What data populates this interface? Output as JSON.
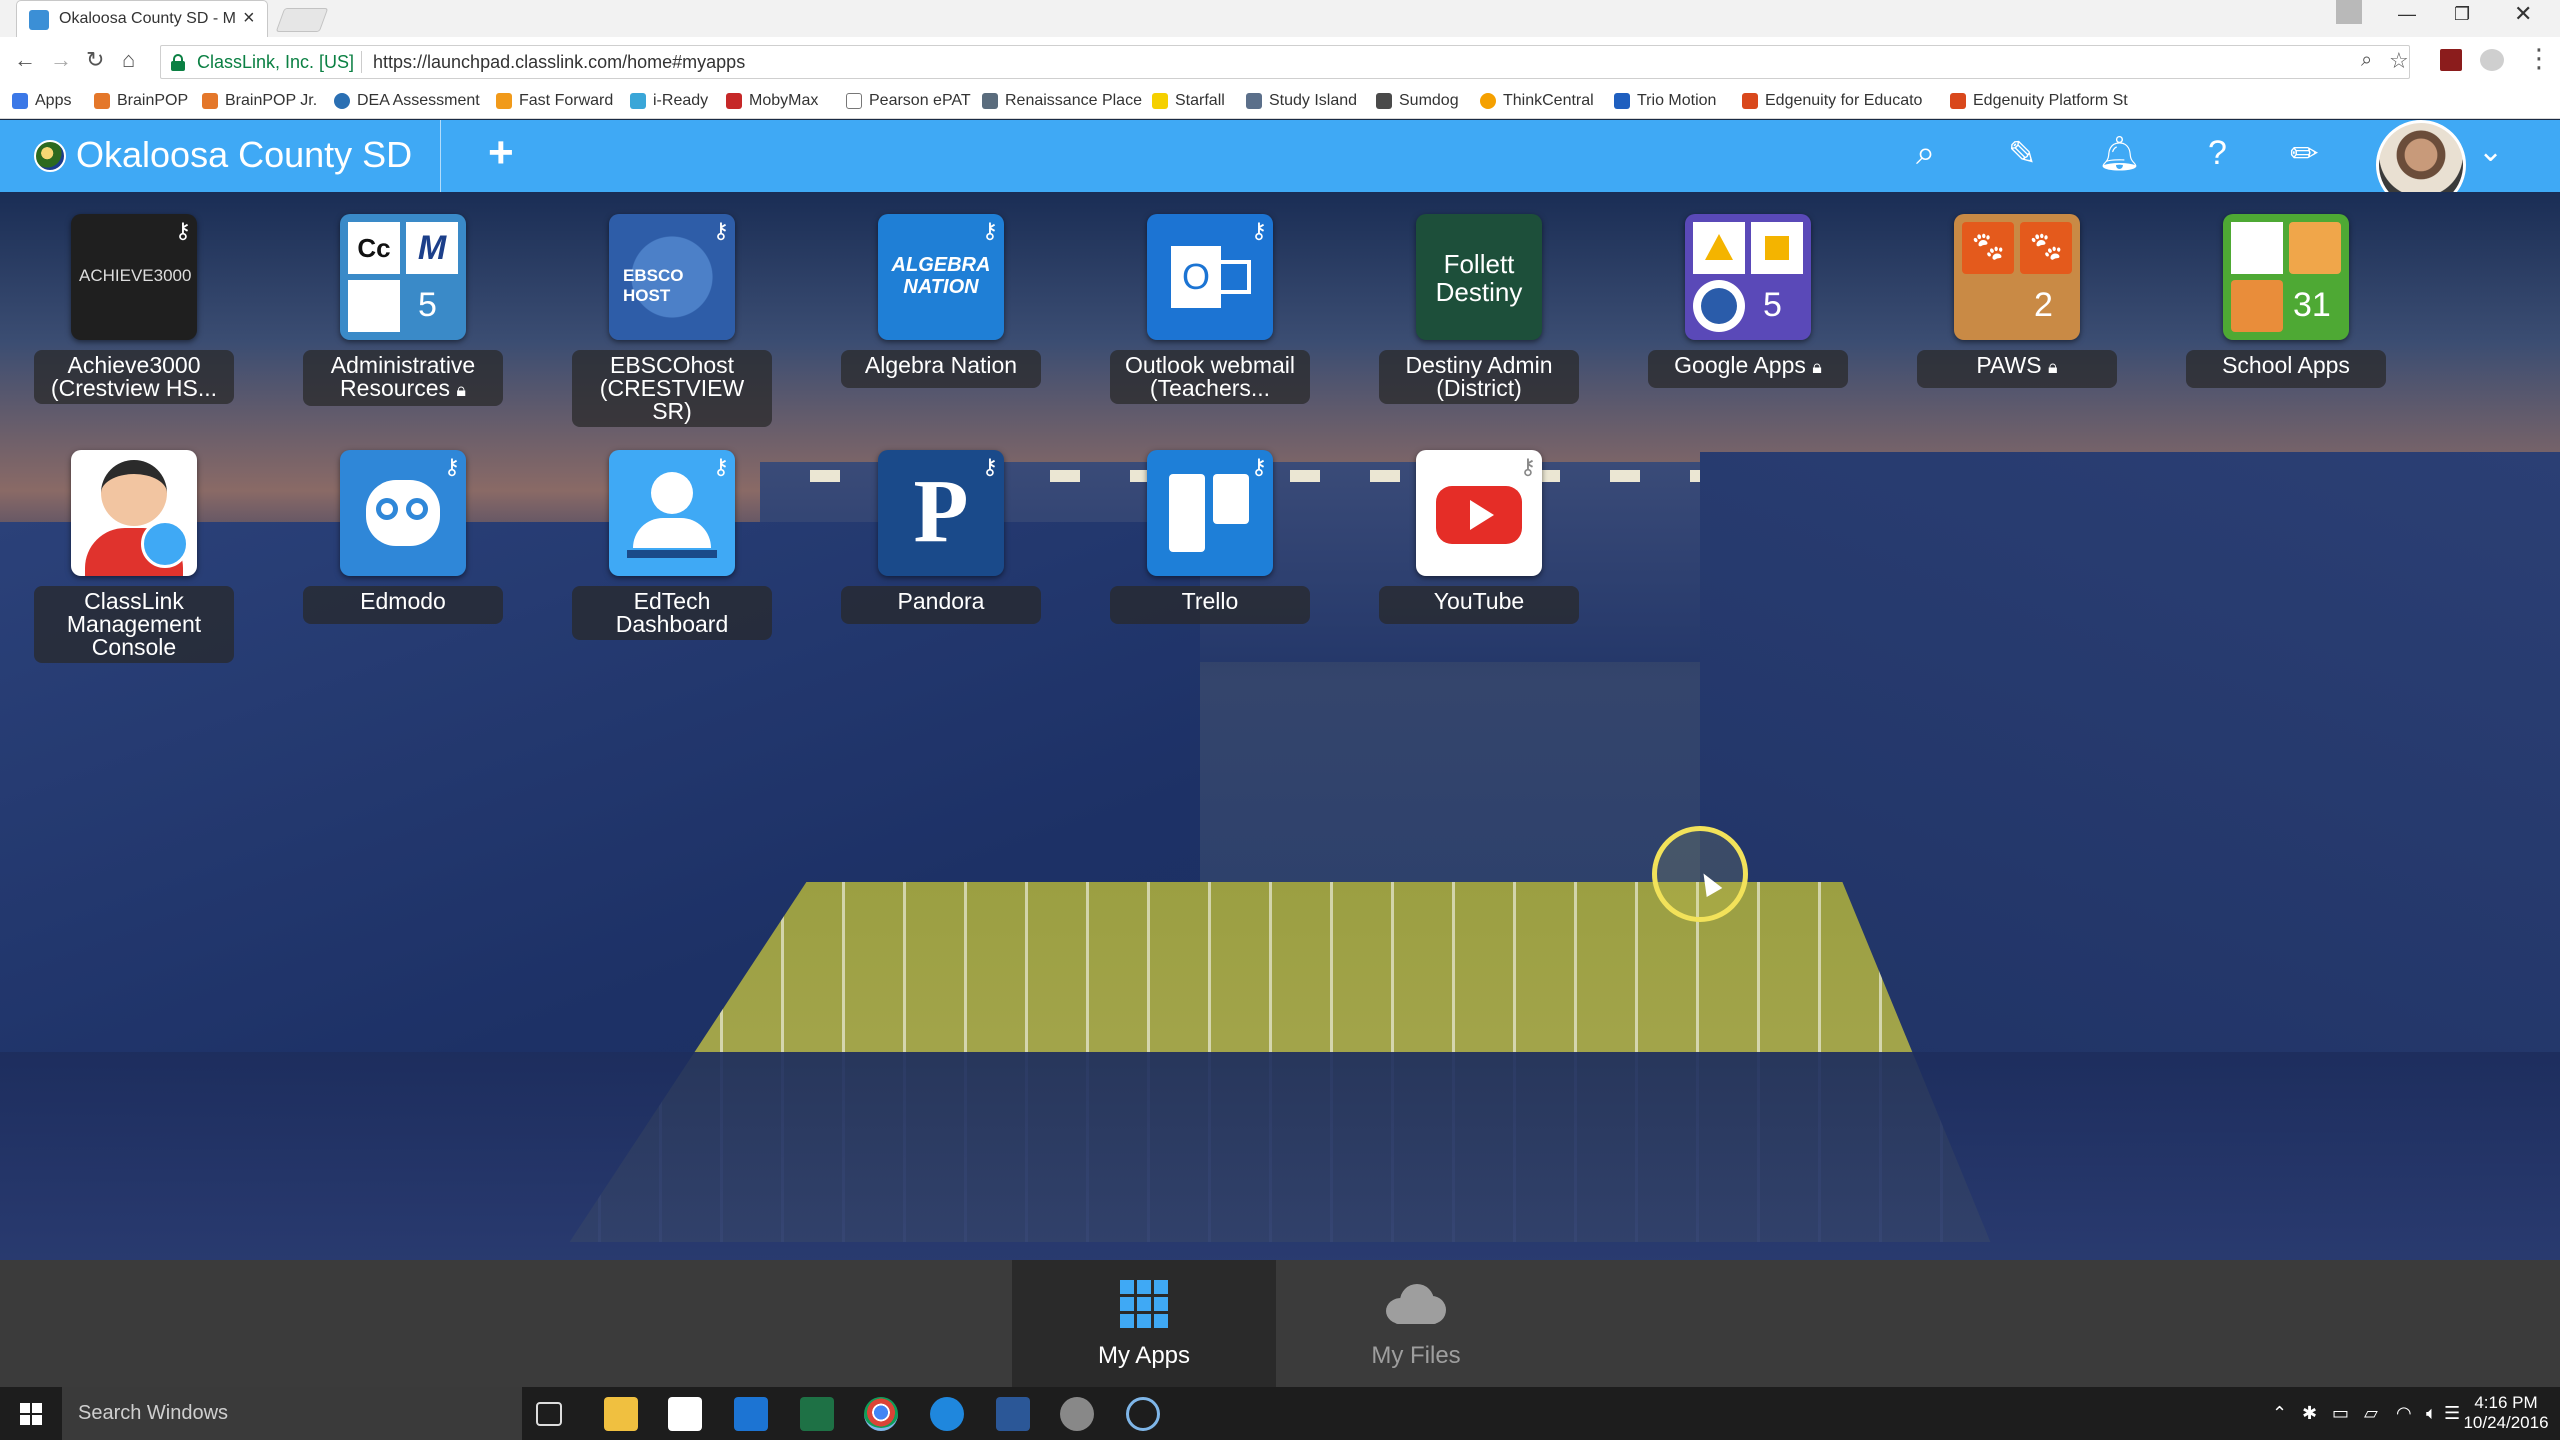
{
  "browser": {
    "tab_title": "Okaloosa County SD - M",
    "secure_label": "ClassLink, Inc. [US]",
    "url": "https://launchpad.classlink.com/home#myapps",
    "bookmarks": [
      "Apps",
      "BrainPOP",
      "BrainPOP Jr.",
      "DEA Assessment",
      "Fast Forward",
      "i-Ready",
      "MobyMax",
      "Pearson ePAT",
      "Renaissance Place",
      "Starfall",
      "Study Island",
      "Sumdog",
      "ThinkCentral",
      "Trio Motion",
      "Edgenuity for Educato",
      "Edgenuity Platform St"
    ]
  },
  "header": {
    "district_name": "Okaloosa County SD",
    "add_icon": "+",
    "icons": [
      "search-icon",
      "compose-icon",
      "bell-icon",
      "help-icon",
      "pencil-icon"
    ]
  },
  "apps": [
    {
      "name": "Achieve3000 (Crestview HS...",
      "icon_text": "ACHIEVE3000",
      "color": "#222222"
    },
    {
      "name": "Administrative Resources",
      "count": "5",
      "locked": true,
      "color": "#3a8ac8"
    },
    {
      "name": "EBSCOhost (CRESTVIEW SR)",
      "icon_text": "EBSCO HOST",
      "color": "#2e5da8"
    },
    {
      "name": "Algebra Nation",
      "icon_text": "ALGEBRA NATION",
      "color": "#1f7fd6"
    },
    {
      "name": "Outlook webmail (Teachers...",
      "icon_text": "O",
      "color": "#1c74d3"
    },
    {
      "name": "Destiny Admin (District)",
      "icon_text": "Follett Destiny",
      "color": "#1d4f3a"
    },
    {
      "name": "Google Apps",
      "count": "5",
      "locked": true,
      "color": "#5a49b8"
    },
    {
      "name": "PAWS",
      "count": "2",
      "locked": true,
      "color": "#c98a45"
    },
    {
      "name": "School Apps",
      "count": "31",
      "locked": false,
      "color": "#4ea934"
    },
    {
      "name": "ClassLink Management Console",
      "color": "#ffffff"
    },
    {
      "name": "Edmodo",
      "color": "#2f87d8"
    },
    {
      "name": "EdTech Dashboard",
      "color": "#3fa9f5"
    },
    {
      "name": "Pandora",
      "icon_text": "P",
      "color": "#1a4a8a"
    },
    {
      "name": "Trello",
      "color": "#1e7fd8"
    },
    {
      "name": "YouTube",
      "color": "#ffffff"
    }
  ],
  "bottom_tabs": [
    {
      "label": "My Apps",
      "active": true
    },
    {
      "label": "My Files",
      "active": false
    }
  ],
  "taskbar": {
    "search_placeholder": "Search Windows",
    "time": "4:16 PM",
    "date": "10/24/2016"
  }
}
